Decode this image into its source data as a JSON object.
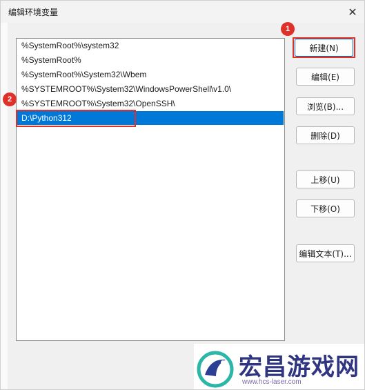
{
  "window": {
    "title": "编辑环境变量",
    "close_glyph": "✕"
  },
  "paths": [
    "%SystemRoot%\\system32",
    "%SystemRoot%",
    "%SystemRoot%\\System32\\Wbem",
    "%SYSTEMROOT%\\System32\\WindowsPowerShell\\v1.0\\",
    "%SYSTEMROOT%\\System32\\OpenSSH\\",
    "D:\\Python312"
  ],
  "selected_index": 5,
  "buttons": {
    "new": "新建(N)",
    "edit": "编辑(E)",
    "browse": "浏览(B)...",
    "delete": "删除(D)",
    "move_up": "上移(U)",
    "move_down": "下移(O)",
    "edit_text": "编辑文本(T)..."
  },
  "annotations": {
    "marker_1": "1",
    "marker_2": "2",
    "color": "#e0302a"
  },
  "watermark": {
    "text": "宏昌游戏网",
    "url": "www.hcs-laser.com"
  },
  "colors": {
    "selection": "#0078d7",
    "accent": "#0067c0"
  }
}
